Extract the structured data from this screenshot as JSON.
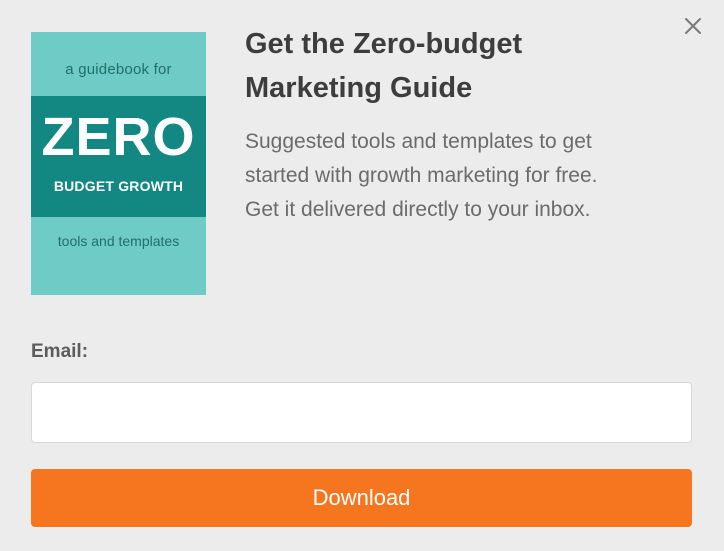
{
  "modal": {
    "close_icon": "close-icon",
    "title_lines": [
      "Get the Zero-budget",
      "Marketing Guide"
    ],
    "description_lines": [
      "Suggested tools and templates to get",
      "started with growth marketing for free.",
      "Get it delivered directly to your inbox."
    ]
  },
  "book_cover": {
    "top_text": "a guidebook for",
    "headline": "ZERO",
    "subheadline": "BUDGET GROWTH",
    "bottom_text": "tools and templates",
    "colors": {
      "background": "#6fcbc6",
      "band": "#138883",
      "text_dark": "#1f6f6c",
      "text_light": "#ffffff"
    }
  },
  "form": {
    "email_label": "Email:",
    "email_value": "",
    "email_placeholder": "",
    "submit_label": "Download",
    "submit_color": "#f6751f"
  }
}
